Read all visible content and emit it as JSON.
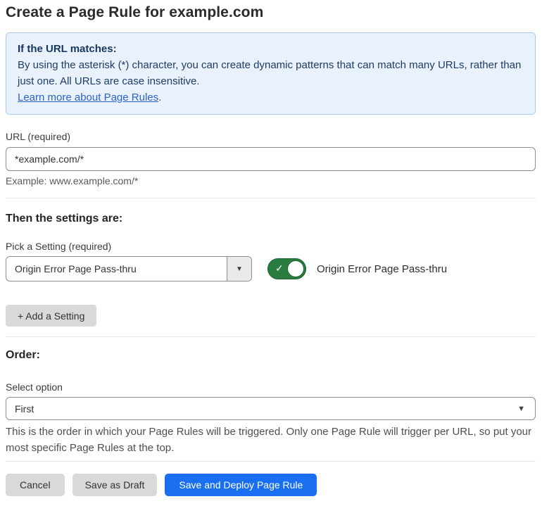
{
  "page": {
    "title": "Create a Page Rule for example.com"
  },
  "info_box": {
    "heading": "If the URL matches:",
    "body": "By using the asterisk (*) character, you can create dynamic patterns that can match many URLs, rather than just one. All URLs are case insensitive.",
    "link_label": "Learn more about Page Rules",
    "link_suffix": "."
  },
  "url_field": {
    "label": "URL (required)",
    "value": "*example.com/*",
    "helper": "Example: www.example.com/*"
  },
  "settings_section": {
    "heading": "Then the settings are:",
    "picker_label": "Pick a Setting (required)",
    "picker_value": "Origin Error Page Pass-thru",
    "toggle_state": "on",
    "toggle_label": "Origin Error Page Pass-thru",
    "add_button_label": "+ Add a Setting"
  },
  "order_section": {
    "heading": "Order:",
    "select_label": "Select option",
    "select_value": "First",
    "helper": "This is the order in which your Page Rules will be triggered. Only one Page Rule will trigger per URL, so put your most specific Page Rules at the top."
  },
  "footer": {
    "cancel_label": "Cancel",
    "save_draft_label": "Save as Draft",
    "save_deploy_label": "Save and Deploy Page Rule"
  },
  "icons": {
    "dropdown_arrow": "▼",
    "check": "✓"
  },
  "colors": {
    "accent_blue": "#1a6ff0",
    "toggle_green": "#287d3f",
    "info_bg": "#e9f2fc",
    "info_border": "#abc9e9",
    "link_blue": "#2b62cc",
    "button_gray": "#d9d9d9"
  }
}
